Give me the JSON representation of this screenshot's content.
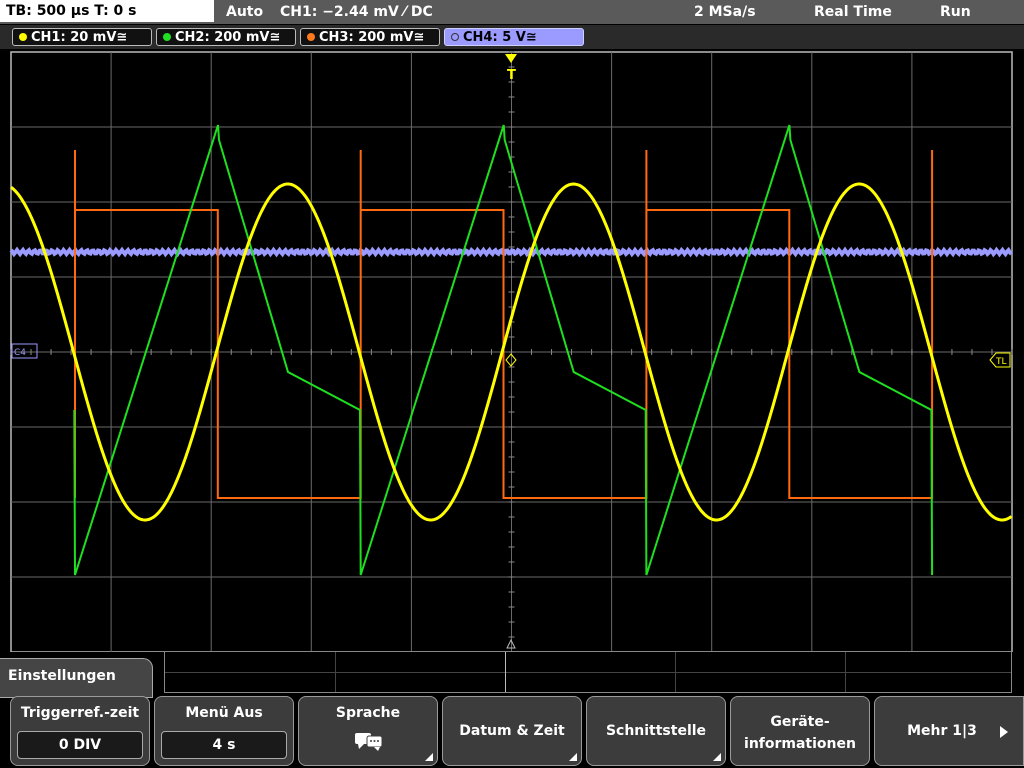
{
  "topbar": {
    "timebase": "TB: 500 µs   T: 0 s",
    "trigger_mode": "Auto",
    "trigger_info": "CH1: −2.44 mV ⁄ DC",
    "sample_rate": "2 MSa/s",
    "acq_mode": "Real Time",
    "run_state": "Run"
  },
  "channels": [
    {
      "label": "CH1: 20 mV≅",
      "color": "#ffff00",
      "active": false
    },
    {
      "label": "CH2: 200 mV≅",
      "color": "#22e022",
      "active": false
    },
    {
      "label": "CH3: 200 mV≅",
      "color": "#ff7a1a",
      "active": false
    },
    {
      "label": "CH4: 5 V≅",
      "color": "#9a9aff",
      "active": true
    }
  ],
  "markers": {
    "trigger_top": "T",
    "trigger_level": "TL",
    "channel_ref": "C4"
  },
  "menu": {
    "title": "Einstellungen",
    "softkeys": [
      {
        "label": "Triggerref.-zeit",
        "value": "0 DIV"
      },
      {
        "label": "Menü Aus",
        "value": "4 s"
      },
      {
        "label": "Sprache",
        "icon": "speech-bubbles-icon"
      },
      {
        "label": "Datum & Zeit"
      },
      {
        "label": "Schnittstelle"
      },
      {
        "label": "Geräte-",
        "label2": "informationen"
      },
      {
        "label": "Mehr 1|3"
      }
    ]
  }
}
